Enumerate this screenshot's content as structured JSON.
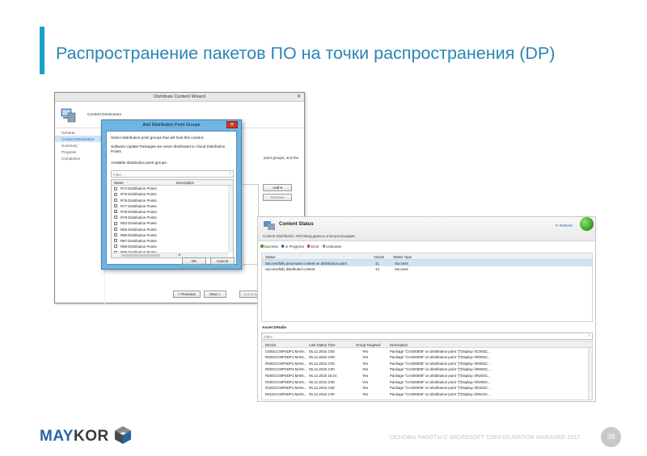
{
  "slide": {
    "title": "Распространение пакетов ПО на точки распространения (DP)",
    "footer": "ОСНОВЫ РАБОТЫ С MICROSOFT CONFIGURATION MANAGER 2012",
    "page_number": "38",
    "logo_left": "MAY",
    "logo_right": "KOR"
  },
  "wizard": {
    "title": "Distribute Content Wizard",
    "header": "Content Destination",
    "steps": [
      "General",
      "Content Destination",
      "Summary",
      "Progress",
      "Completion"
    ],
    "description": "point groups, and the",
    "add_label": "Add",
    "remove_label": "Remove",
    "previous_label": "< Previous",
    "next_label": "Next >",
    "summary_label": "Summar"
  },
  "dp_dialog": {
    "title": "Add Distribution Point Groups",
    "instruction": "Select distribution point groups that will host this content.",
    "note": "Software Update Packages are never distributed to Cloud Distribution Points",
    "list_label": "Available distribution point groups:",
    "filter_placeholder": "Filter...",
    "col_name": "Name",
    "col_description": "Description",
    "rows": [
      {
        "name": "R74 Distribution Points",
        "check": ""
      },
      {
        "name": "R75 Distribution Points",
        "check": ""
      },
      {
        "name": "R76 Distribution Points",
        "check": ""
      },
      {
        "name": "R77 Distribution Points",
        "check": ""
      },
      {
        "name": "R78 Distribution Points",
        "check": "✓"
      },
      {
        "name": "R79 Distribution Points",
        "check": ""
      },
      {
        "name": "R83 Distribution Points",
        "check": ""
      },
      {
        "name": "R85 Distribution Points",
        "check": ""
      },
      {
        "name": "R86 Distribution Points",
        "check": ""
      },
      {
        "name": "R87 Distribution Points",
        "check": ""
      },
      {
        "name": "R89 Distribution Points",
        "check": ""
      },
      {
        "name": "R95 Distribution Points",
        "check": ""
      }
    ],
    "ok_label": "OK",
    "cancel_label": "Cancel"
  },
  "content_status": {
    "title": "Content Status",
    "subtitle": "Content Distribution: R00 Ввод данных электротеродами",
    "refresh_label": "Refresh",
    "tabs": [
      {
        "label": "Success",
        "color": "#2e9c16"
      },
      {
        "label": "In Progress",
        "color": "#2a63a7"
      },
      {
        "label": "Error",
        "color": "#c9392b"
      },
      {
        "label": "Unknown",
        "color": "#888888"
      }
    ],
    "summary_cols": [
      "Status",
      "Assets",
      "Status Type"
    ],
    "summary_rows": [
      [
        "Successfully processed content on distribution point",
        "11",
        "Success"
      ],
      [
        "Successfully distributed content",
        "14",
        "Success"
      ]
    ],
    "asset_details_label": "Asset Details",
    "filter_placeholder": "Filter...",
    "asset_cols": [
      "Device",
      "Last Status Time",
      "Group Targeted",
      "Description"
    ],
    "asset_rows": [
      [
        "C00SCCMPSDP1.MAIN...",
        "05.12.2015 3:00",
        "Yes",
        "Package \"CAS00008\" on distribution point \"[\"Display=\\\\C00SC..."
      ],
      [
        "R00SCCMPSDP1.MAIN...",
        "05.12.2015 3:00",
        "Yes",
        "Package \"CAS00008\" on distribution point \"[\"Display=\\\\R00SC..."
      ],
      [
        "R00SCCMPSDP2.MAIN...",
        "05.12.2015 3:00",
        "Yes",
        "Package \"CAS00008\" on distribution point \"[\"Display=\\\\R00SC..."
      ],
      [
        "R00SCCMPSDP3.MAIN...",
        "05.12.2015 3:00",
        "Yes",
        "Package \"CAS00008\" on distribution point \"[\"Display=\\\\R00SC..."
      ],
      [
        "R25SCCMPSDP1.MAIN...",
        "06.12.2015 16:24",
        "Yes",
        "Package \"CAS00008\" on distribution point \"[\"Display=\\\\R25SC..."
      ],
      [
        "R29SCCMPSDP1.MAIN...",
        "05.12.2015 3:00",
        "Yes",
        "Package \"CAS00008\" on distribution point \"[\"Display=\\\\R29SC..."
      ],
      [
        "R32SCCMPSDP1.MAIN...",
        "05.12.2015 3:00",
        "Yes",
        "Package \"CAS00008\" on distribution point \"[\"Display=\\\\R32SC..."
      ],
      [
        "R61SCCMPSDP1.MAIN...",
        "05.12.2015 2:00",
        "Yes",
        "Package \"CAS00008\" on distribution point \"[\"Display=\\\\R61SC..."
      ]
    ]
  }
}
